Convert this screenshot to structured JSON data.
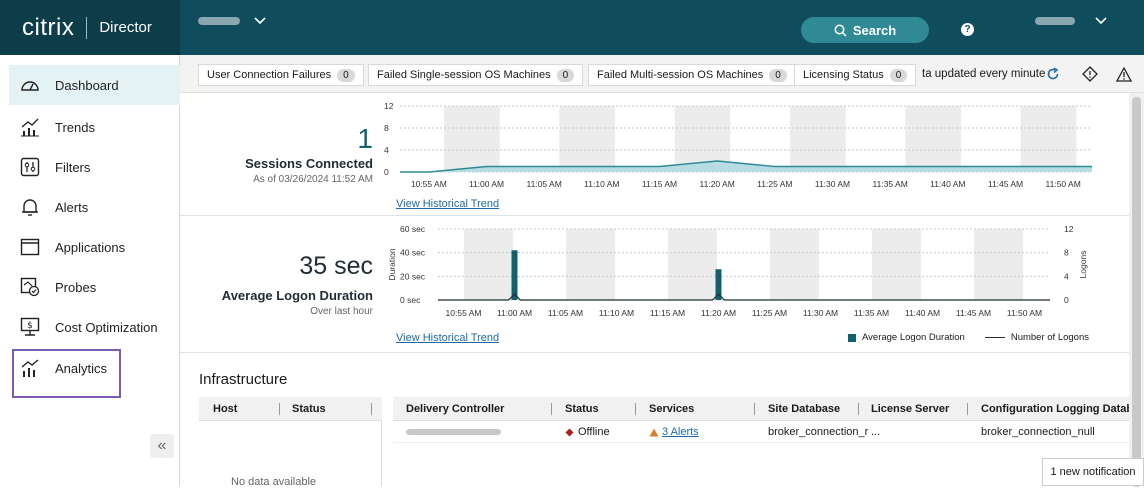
{
  "header": {
    "logo": "citrix",
    "app_name": "Director",
    "search_label": "Search",
    "help_glyph": "?"
  },
  "sidebar": {
    "items": [
      {
        "label": "Dashboard",
        "icon": "dashboard-icon",
        "active": true
      },
      {
        "label": "Trends",
        "icon": "trends-icon"
      },
      {
        "label": "Filters",
        "icon": "filters-icon"
      },
      {
        "label": "Alerts",
        "icon": "bell-icon"
      },
      {
        "label": "Applications",
        "icon": "applications-icon"
      },
      {
        "label": "Probes",
        "icon": "probes-icon"
      },
      {
        "label": "Cost Optimization",
        "icon": "cost-optimization-icon"
      },
      {
        "label": "Analytics",
        "icon": "analytics-icon"
      }
    ],
    "collapse_glyph": "«"
  },
  "toolbar": {
    "chips": [
      {
        "label": "User Connection Failures",
        "count": "0"
      },
      {
        "label": "Failed Single-session OS Machines",
        "count": "0"
      },
      {
        "label": "Failed Multi-session OS Machines",
        "count": "0"
      },
      {
        "label": "Licensing Status",
        "count": "0"
      }
    ],
    "updated_text": "ta updated every minute"
  },
  "sessions": {
    "value": "1",
    "label": "Sessions Connected",
    "as_of": "As of 03/26/2024 11:52 AM",
    "link": "View Historical Trend"
  },
  "logon": {
    "value": "35 sec",
    "label": "Average Logon Duration",
    "sub": "Over last hour",
    "link": "View Historical Trend"
  },
  "chart_data": [
    {
      "type": "area",
      "x": [
        "10:55 AM",
        "11:00 AM",
        "11:05 AM",
        "11:10 AM",
        "11:15 AM",
        "11:20 AM",
        "11:25 AM",
        "11:30 AM",
        "11:35 AM",
        "11:40 AM",
        "11:45 AM",
        "11:50 AM"
      ],
      "series": [
        {
          "values": [
            0,
            1,
            1,
            1,
            1,
            2,
            1,
            1,
            1,
            1,
            1,
            1
          ]
        }
      ],
      "yticks": [
        "12",
        "8",
        "4",
        "0"
      ],
      "ylim": [
        0,
        12
      ],
      "grid": true
    },
    {
      "type": "bar",
      "x": [
        "10:55 AM",
        "11:00 AM",
        "11:05 AM",
        "11:10 AM",
        "11:15 AM",
        "11:20 AM",
        "11:25 AM",
        "11:30 AM",
        "11:35 AM",
        "11:40 AM",
        "11:45 AM",
        "11:50 AM"
      ],
      "series": [
        {
          "name": "Average Logon Duration",
          "values": [
            0,
            42,
            0,
            0,
            0,
            26,
            0,
            0,
            0,
            0,
            0,
            0
          ]
        },
        {
          "name": "Number of Logons",
          "values": [
            0,
            1,
            0,
            0,
            0,
            1,
            0,
            0,
            0,
            0,
            0,
            0
          ]
        }
      ],
      "yticks_left": [
        "60 sec",
        "40 sec",
        "20 sec",
        "0 sec"
      ],
      "yticks_right": [
        "12",
        "8",
        "4",
        "0"
      ],
      "ylabel": "Duration",
      "ylabel_right": "Logons",
      "ylim": [
        0,
        60
      ],
      "ylim_right": [
        0,
        12
      ],
      "legend": "bottom-right",
      "colors": {
        "bar": "#12606e",
        "line": "#1f2d33"
      }
    }
  ],
  "infrastructure": {
    "title": "Infrastructure",
    "host_table": {
      "columns": [
        "Host",
        "Status"
      ],
      "empty_text": "No data available"
    },
    "controller_table": {
      "columns": [
        "Delivery Controller",
        "Status",
        "Services",
        "Site Database",
        "License Server",
        "Configuration Logging Databa"
      ],
      "rows": [
        {
          "status": "Offline",
          "services": "3 Alerts",
          "site_db": "broker_connection_r",
          "license": "...",
          "config_db": "broker_connection_null"
        }
      ]
    }
  },
  "notification": "1 new notification",
  "colors": {
    "header": "#0f4c5c",
    "accent": "#2f8a95",
    "offline": "#b0211b",
    "alert": "#d9822b"
  }
}
